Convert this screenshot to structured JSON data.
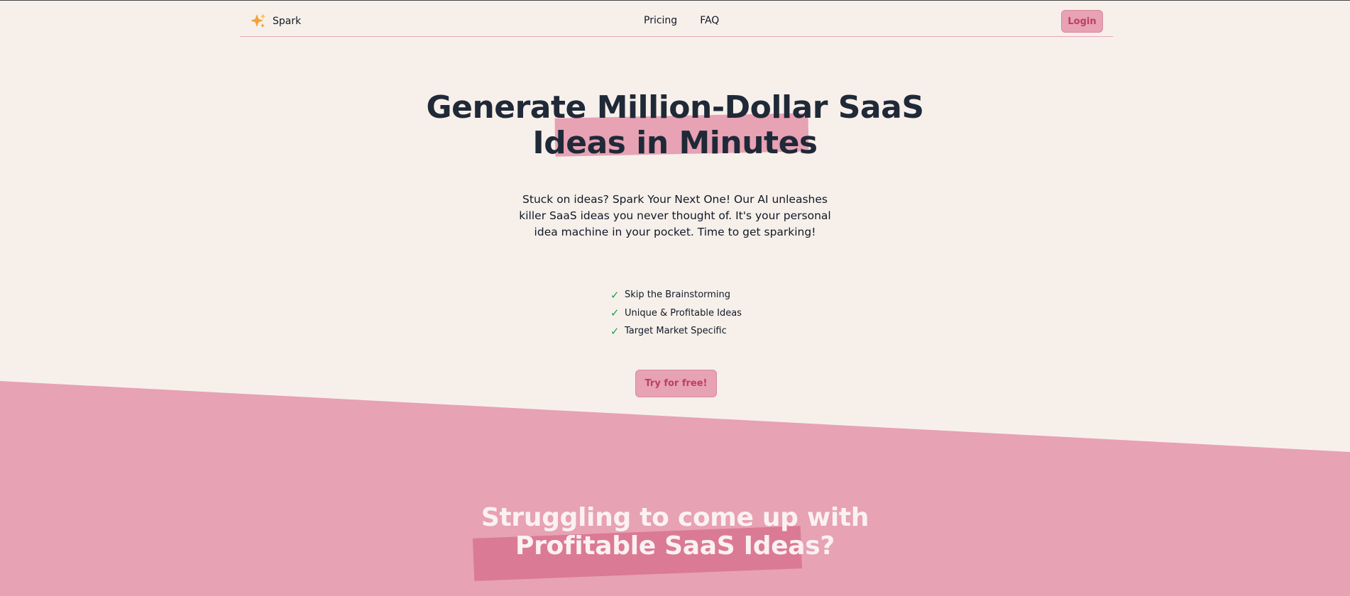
{
  "nav": {
    "brand": "Spark",
    "links": [
      "Pricing",
      "FAQ"
    ],
    "login_label": "Login"
  },
  "hero": {
    "title_line1": "Generate Million-Dollar SaaS",
    "title_line2": "Ideas in Minutes",
    "description": "Stuck on ideas? Spark Your Next One! Our AI unleashes killer SaaS ideas you never thought of. It's your personal idea machine in your pocket. Time to get sparking!",
    "features": [
      "Skip the Brainstorming",
      "Unique & Profitable Ideas",
      "Target Market Specific"
    ],
    "cta_label": "Try for free!"
  },
  "section2": {
    "title_line1": "Struggling to come up with",
    "title_line2": "Profitable SaaS Ideas?"
  },
  "colors": {
    "background": "#f7f0ea",
    "accent_pink": "#e7a2b4",
    "deep_pink": "#db7a94",
    "button_text": "#be3e63",
    "check_green": "#16a34a"
  },
  "icons": {
    "brand": "sparkles-icon",
    "feature": "check-icon"
  }
}
